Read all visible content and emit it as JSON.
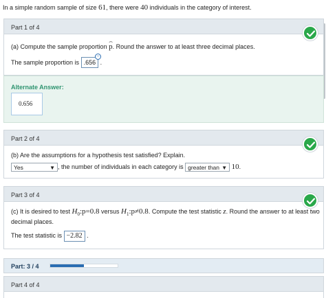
{
  "intro": {
    "prefix": "In a simple random sample of size ",
    "n": "61",
    "middle": ", there were ",
    "x": "40",
    "suffix": " individuals in the category of interest."
  },
  "part1": {
    "header": "Part 1 of 4",
    "question_prefix": "(a) Compute the sample proportion ",
    "question_symbol": "p",
    "question_suffix": ". Round the answer to at least three decimal places.",
    "answer_label": "The sample proportion is ",
    "answer_value": ".656",
    "answer_after": ".",
    "alternate_title": "Alternate Answer:",
    "alternate_value": "0.656"
  },
  "part2": {
    "header": "Part 2 of 4",
    "question": "(b) Are the assumptions for a hypothesis test satisfied? Explain.",
    "select1_value": "Yes",
    "middle_text": ", the number of individuals in each category is ",
    "select2_value": "greater than",
    "end_value": "10",
    "end_period": "."
  },
  "part3": {
    "header": "Part 3 of 4",
    "question_prefix": "(c) It is desired to test ",
    "h0": "H",
    "h0_sub": "0",
    "h0_rest": ":p=0.8",
    "versus": " versus ",
    "h1": "H",
    "h1_sub": "1",
    "h1_rest": ":p≠0.8",
    "question_mid": ". Compute the test statistic ",
    "z": "z",
    "question_suffix": ". Round the answer to at least two",
    "question_line2": "decimal places.",
    "answer_label": "The test statistic is ",
    "answer_value": "−2.82",
    "answer_after": "."
  },
  "progress": {
    "label": "Part: ",
    "current": "3",
    "separator": " / ",
    "total": "4",
    "fraction": 0.5
  },
  "part4": {
    "header": "Part 4 of 4"
  },
  "colors": {
    "check_green": "#2aa84a",
    "alternate_green": "#2f9470",
    "progress_blue": "#2a6db2"
  }
}
